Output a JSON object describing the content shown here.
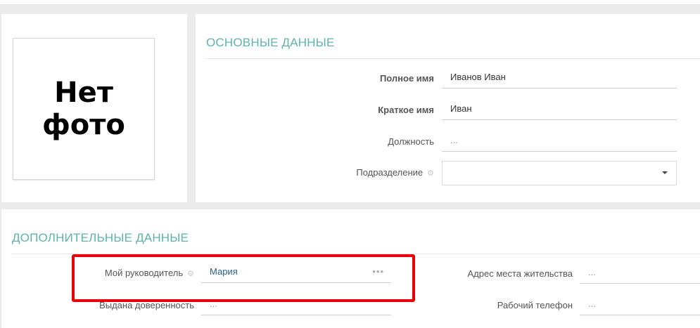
{
  "photo": {
    "placeholder_text": "Нет\nфото"
  },
  "main_section": {
    "title": "ОСНОВНЫЕ ДАННЫЕ",
    "fields": {
      "full_name": {
        "label": "Полное имя",
        "value": "Иванов Иван"
      },
      "short_name": {
        "label": "Краткое имя",
        "value": "Иван"
      },
      "position": {
        "label": "Должность",
        "value": "..."
      },
      "department": {
        "label": "Подразделение",
        "value": ""
      }
    }
  },
  "extra_section": {
    "title": "ДОПОЛНИТЕЛЬНЫЕ ДАННЫЕ",
    "fields": {
      "manager": {
        "label": "Мой руководитель",
        "value": "Мария",
        "more": "•••"
      },
      "power_of_attorney": {
        "label": "Выдана доверенность",
        "value": "..."
      },
      "address": {
        "label": "Адрес места жительства",
        "value": "..."
      },
      "work_phone": {
        "label": "Рабочий телефон",
        "value": "..."
      }
    }
  },
  "icons": {
    "gear": "gear-icon",
    "dropdown": "chevron-down-icon",
    "more": "more-icon"
  },
  "colors": {
    "accent": "#5bb5ab",
    "highlight": "#e8000b",
    "link": "#2a5f8f"
  }
}
